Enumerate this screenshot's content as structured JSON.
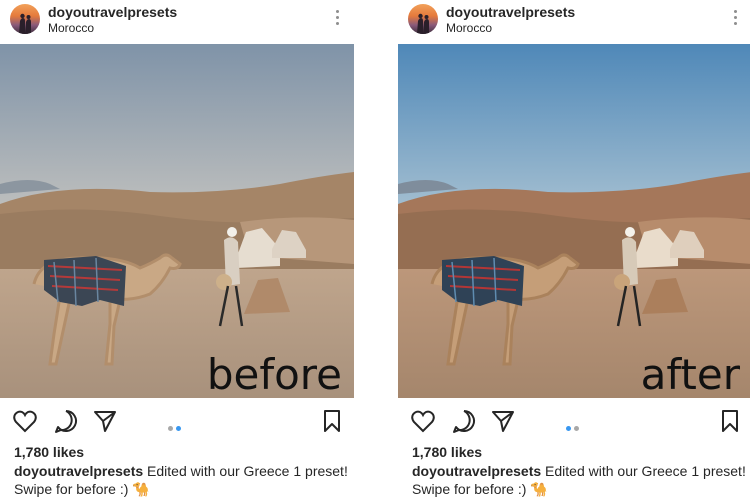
{
  "posts": [
    {
      "username": "doyoutravelpresets",
      "location": "Morocco",
      "overlay_text": "before",
      "likes": "1,780 likes",
      "caption_user": "doyoutravelpresets",
      "caption_text": " Edited with our Greece 1 preset!",
      "caption_line2": "Swipe for before :) 🐪",
      "carousel": {
        "count": 2,
        "active_index": 1
      },
      "colors": {
        "sky_top": "#7f93a8",
        "sky_bottom": "#c9c7c2",
        "ground": "#b59c84",
        "dune": "#a58567"
      }
    },
    {
      "username": "doyoutravelpresets",
      "location": "Morocco",
      "overlay_text": "after",
      "likes": "1,780 likes",
      "caption_user": "doyoutravelpresets",
      "caption_text": " Edited with our Greece 1 preset!",
      "caption_line2": "Swipe for before :) 🐪",
      "carousel": {
        "count": 2,
        "active_index": 0
      },
      "colors": {
        "sky_top": "#4f88b8",
        "sky_bottom": "#a8c3d2",
        "ground": "#b28e73",
        "dune": "#a5775a"
      }
    }
  ],
  "colors": {
    "dot_active": "#3897f0",
    "dot_inactive": "#a8a8a8",
    "icon": "#262626"
  },
  "icons": [
    "heart-icon",
    "comment-icon",
    "share-icon",
    "bookmark-icon",
    "more-icon"
  ]
}
